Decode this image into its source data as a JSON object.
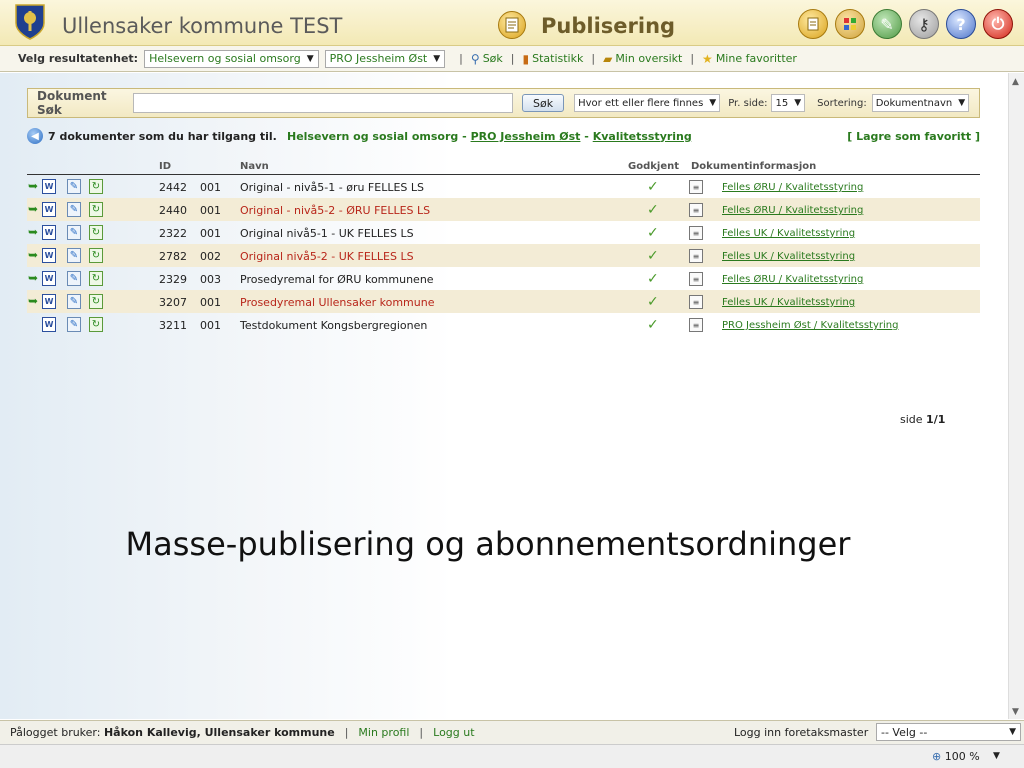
{
  "header": {
    "app_title": "Ullensaker kommune TEST",
    "module_title": "Publisering"
  },
  "toolbar": {
    "label": "Velg resultatenhet:",
    "unit_select": "Helsevern og sosial omsorg",
    "subunit_select": "PRO Jessheim Øst",
    "links": [
      "Søk",
      "Statistikk",
      "Min oversikt",
      "Mine favoritter"
    ]
  },
  "search": {
    "label": "Dokument Søk",
    "input_value": "",
    "button": "Søk",
    "mode_select": "Hvor ett eller flere finnes",
    "per_page_label": "Pr. side:",
    "per_page_value": "15",
    "sort_label": "Sortering:",
    "sort_value": "Dokumentnavn"
  },
  "info": {
    "count_text": "7 dokumenter som du har tilgang til.",
    "crumb_root": "Helsevern og sosial omsorg",
    "crumb_dash": "-",
    "crumb_unit": "PRO Jessheim Øst",
    "crumb_area": "Kvalitetsstyring",
    "save_favorite": "[ Lagre som favoritt ]"
  },
  "table": {
    "columns": [
      "ID",
      "Navn",
      "Godkjent",
      "Dokumentinformasjon"
    ],
    "rows": [
      {
        "id": "2442",
        "ver": "001",
        "name": "Original - nivå5-1 - øru FELLES LS",
        "red": false,
        "info": "Felles ØRU / Kvalitetsstyring",
        "arrow": true
      },
      {
        "id": "2440",
        "ver": "001",
        "name": "Original - nivå5-2 - ØRU FELLES LS",
        "red": true,
        "info": "Felles ØRU / Kvalitetsstyring",
        "arrow": true
      },
      {
        "id": "2322",
        "ver": "001",
        "name": "Original nivå5-1 - UK FELLES LS",
        "red": false,
        "info": "Felles UK / Kvalitetsstyring",
        "arrow": true
      },
      {
        "id": "2782",
        "ver": "002",
        "name": "Original nivå5-2 - UK FELLES LS",
        "red": true,
        "info": "Felles UK / Kvalitetsstyring",
        "arrow": true
      },
      {
        "id": "2329",
        "ver": "003",
        "name": "Prosedyremal for ØRU kommunene",
        "red": false,
        "info": "Felles ØRU / Kvalitetsstyring",
        "arrow": true
      },
      {
        "id": "3207",
        "ver": "001",
        "name": "Prosedyremal Ullensaker kommune",
        "red": true,
        "info": "Felles UK / Kvalitetsstyring",
        "arrow": true
      },
      {
        "id": "3211",
        "ver": "001",
        "name": "Testdokument Kongsbergregionen",
        "red": false,
        "info": "PRO Jessheim Øst / Kvalitetsstyring",
        "arrow": false
      }
    ]
  },
  "pagination": {
    "label": "side",
    "value": "1/1"
  },
  "overlay_text": "Masse-publisering og abonnementsordninger",
  "status": {
    "user_label": "Pålogget bruker:",
    "user_name": "Håkon Kallevig, Ullensaker kommune",
    "profile": "Min profil",
    "logout": "Logg ut",
    "master_label": "Logg inn foretaksmaster",
    "master_select": "-- Velg --"
  },
  "zoom": "100 %",
  "colors": {
    "link_green": "#2a7a1e",
    "red_text": "#b8261a",
    "alt_row": "#f3ecd6"
  }
}
